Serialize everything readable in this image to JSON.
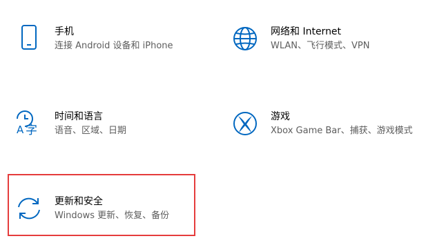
{
  "accent_color": "#0067c0",
  "highlight_color": "#e53b3b",
  "tiles": [
    {
      "icon": "phone-icon",
      "title": "手机",
      "description": "连接 Android 设备和 iPhone"
    },
    {
      "icon": "globe-icon",
      "title": "网络和 Internet",
      "description": "WLAN、飞行模式、VPN"
    },
    {
      "icon": "time-language-icon",
      "title": "时间和语言",
      "description": "语音、区域、日期"
    },
    {
      "icon": "xbox-icon",
      "title": "游戏",
      "description": "Xbox Game Bar、捕获、游戏模式"
    },
    {
      "icon": "sync-icon",
      "title": "更新和安全",
      "description": "Windows 更新、恢复、备份"
    }
  ]
}
